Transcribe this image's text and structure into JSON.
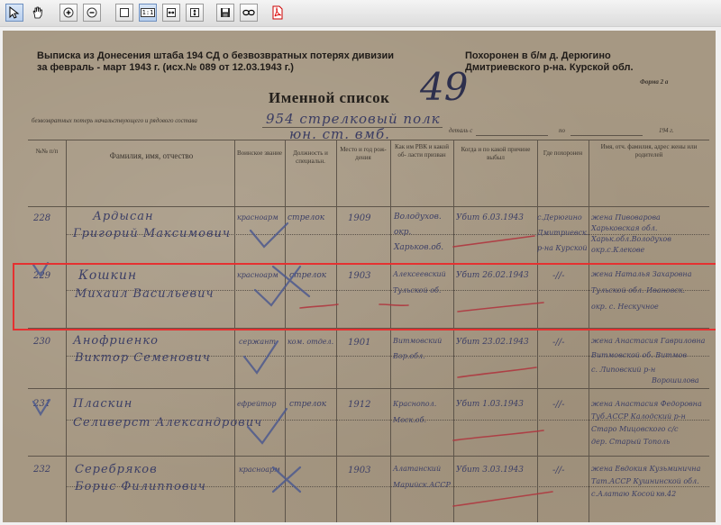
{
  "toolbar": {
    "buttons": [
      {
        "name": "pointer-tool-button",
        "icon": "arrow-pointer-icon"
      },
      {
        "name": "hand-tool-button",
        "icon": "hand-icon"
      },
      {
        "name": "zoom-in-button",
        "icon": "zoom-in-icon"
      },
      {
        "name": "zoom-out-button",
        "icon": "zoom-out-icon"
      },
      {
        "name": "fit-page-button",
        "icon": "fit-page-icon"
      },
      {
        "name": "actual-size-button",
        "icon": "actual-size-icon",
        "label": "1:1"
      },
      {
        "name": "fit-width-button",
        "icon": "fit-width-icon"
      },
      {
        "name": "fit-height-button",
        "icon": "fit-height-icon"
      },
      {
        "name": "save-button",
        "icon": "floppy-disk-icon"
      },
      {
        "name": "link-button",
        "icon": "link-icon"
      },
      {
        "name": "pdf-export-button",
        "icon": "pdf-icon"
      }
    ]
  },
  "document": {
    "header_left_line1": "Выписка из Донесения штаба 194 СД о безвозвратных потерях дивизии",
    "header_left_line2": "за февраль - март 1943 г. (исх.№ 089 от 12.03.1943 г.)",
    "header_right_line1": "Похоронен в б/м д. Дерюгино",
    "header_right_line2": "Дмитриевского р-на. Курской обл.",
    "form_label": "Форма 2 а",
    "title": "Именной список",
    "subtitle_prefix": "безвозвратных потерь начальствующего и рядового  состава",
    "subtitle_handwritten_1": "954 стрелковый полк",
    "subtitle_handwritten_2": "юн. ст. вмб.",
    "big_handwritten_number": "49",
    "date_label": "деталь с",
    "date_to": "по",
    "year_suffix": "194   г.",
    "columns": {
      "num": "№№ п/п",
      "name": "Фамилия, имя, отчество",
      "rank": "Воинское звание",
      "position": "Должность и специальн.",
      "birth": "Место и год рож- дения",
      "rvk": "Как им РВК и какой об- ласти призван",
      "when": "Когда и по какой причине выбыл",
      "buried": "Где похоронен",
      "relatives": "Имя, отч. фамилия, адрес жены или родителей"
    },
    "rows": [
      {
        "num": "228",
        "surname": "Ардысан",
        "given": "Григорий Максимович",
        "rank": "красноарм",
        "position": "стрелок",
        "birth_year": "1909",
        "rvk_1": "Володухов.",
        "rvk_2": "окр.",
        "rvk_3": "Харьков.об.",
        "event": "Убит 6.03.1943",
        "buried_1": "с.Дерюгино",
        "buried_2": "Дмитриевск.",
        "buried_3": "р-на Курской",
        "rel_1": "жена Пивоварова",
        "rel_2": "Харьковская обл.",
        "rel_3": "Харьк.обл.Володухов",
        "rel_4": "окр.с.Клекове"
      },
      {
        "num": "229",
        "surname": "Кошкин",
        "given": "Михаил Васильевич",
        "rank": "красноарм",
        "position": "стрелок",
        "birth_year": "1903",
        "rvk_1": "Алексеевский",
        "rvk_2": "Тульской об.",
        "event": "Убит 26.02.1943",
        "buried_1": "-//-",
        "rel_1": "жена Наталья Захаровна",
        "rel_2": "Тульской обл. Ивановск.",
        "rel_3": "окр. с. Нескучное"
      },
      {
        "num": "230",
        "surname": "Анофриенко",
        "given": "Виктор Семенович",
        "rank": "сержант",
        "position": "ком. отдел.",
        "birth_year": "1901",
        "rvk_1": "Витмовский",
        "rvk_2": "Вор.обл.",
        "event": "Убит 23.02.1943",
        "buried_1": "-//-",
        "rel_1": "жена Анастасия Гавриловна",
        "rel_2": "Витмовской об. Витмов",
        "rel_3": "с. Липовский р-н",
        "rel_4": "Ворошилова"
      },
      {
        "num": "231",
        "surname": "Пласкин",
        "given": "Селиверст Александрович",
        "rank": "ефрейтор",
        "position": "стрелок",
        "birth_year": "1912",
        "rvk_1": "Краснопол.",
        "rvk_2": "Моск.об.",
        "event": "Убит 1.03.1943",
        "buried_1": "-//-",
        "rel_1": "жена Анастасия Федоровна",
        "rel_2": "Туб.АССР Калодский р-н",
        "rel_3": "Старо Мицовского с/с",
        "rel_4": "дер. Старый Тополь"
      },
      {
        "num": "232",
        "surname": "Серебряков",
        "given": "Борис Филиппович",
        "rank": "красноарм",
        "position": "",
        "birth_year": "1903",
        "rvk_1": "Алатанский",
        "rvk_2": "Марийск.АССР",
        "event": "Убит 3.03.1943",
        "buried_1": "-//-",
        "rel_1": "жена Евдокия Кузьминична",
        "rel_2": "Тат.АССР Кушнинской обл.",
        "rel_3": "с.Алатаю Косой",
        "rel_4": "кв.42"
      }
    ]
  }
}
